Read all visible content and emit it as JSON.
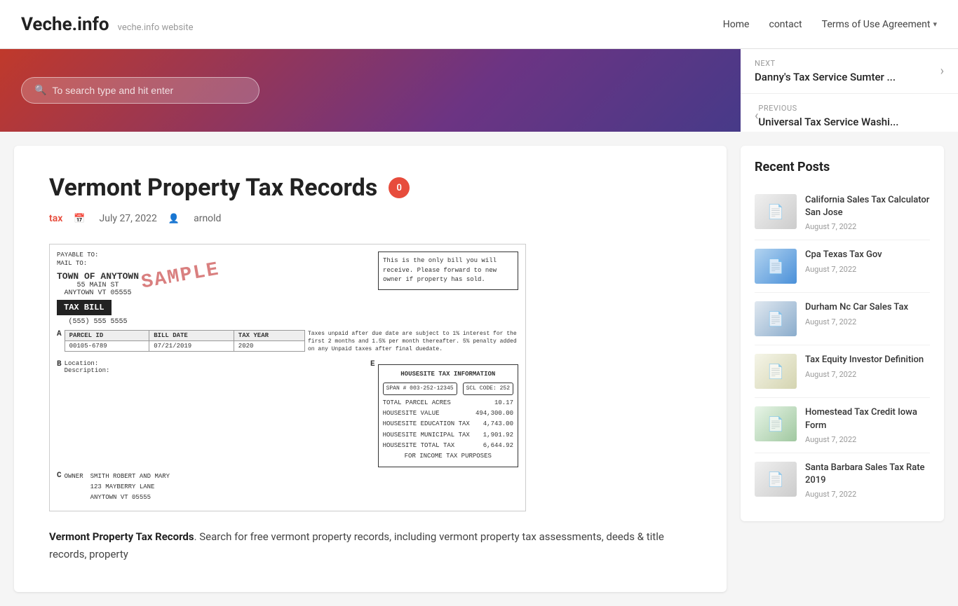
{
  "header": {
    "site_title": "Veche.info",
    "site_tagline": "veche.info website",
    "nav": {
      "home": "Home",
      "contact": "contact",
      "terms": "Terms of Use Agreement"
    }
  },
  "hero": {
    "search_placeholder": "To search type and hit enter"
  },
  "next_nav": {
    "label": "NEXT",
    "title": "Danny's Tax Service Sumter ..."
  },
  "prev_nav": {
    "label": "PREVIOUS",
    "title": "Universal Tax Service Washi..."
  },
  "article": {
    "title": "Vermont Property Tax Records",
    "comment_count": "0",
    "meta_tag": "tax",
    "meta_date": "July 27, 2022",
    "meta_author": "arnold",
    "tax_bill": {
      "payable_to": "PAYABLE TO:",
      "mail_to": "MAIL TO:",
      "sample": "SAMPLE",
      "town": "TOWN OF ANYTOWN",
      "address1": "55 MAIN ST",
      "address2": "ANYTOWN VT 05555",
      "phone": "(555) 555 5555",
      "title": "TAX BILL",
      "note_d": "This is the only bill you will receive. Please forward to new owner if property has sold.",
      "parcel_id": "00105-6789",
      "bill_date": "07/21/2019",
      "tax_year": "2020",
      "interest_note": "Taxes unpaid after due date are subject to 1% interest for the first 2 months and 1.5% per month thereafter. 5% penalty added on any Unpaid taxes after final duedate.",
      "location_label": "Location:",
      "description_label": "Description:",
      "owner_label": "OWNER",
      "owner_name": "SMITH ROBERT AND MARY",
      "owner_addr1": "123 MAYBERRY LANE",
      "owner_addr2": "ANYTOWN VT 05555",
      "housesite_title": "HOUSESITE TAX INFORMATION",
      "span_num": "SPAN # 003-252-12345",
      "scl_code": "SCL CODE: 252",
      "total_parcel_acres_label": "TOTAL PARCEL ACRES",
      "total_parcel_acres_val": "10.17",
      "housesite_value_label": "HOUSESITE VALUE",
      "housesite_value_val": "494,300.00",
      "edu_tax_label": "HOUSESITE EDUCATION TAX",
      "edu_tax_val": "4,743.00",
      "muni_tax_label": "HOUSESITE MUNICIPAL TAX",
      "muni_tax_val": "1,901.92",
      "total_tax_label": "HOUSESITE TOTAL TAX",
      "total_tax_val": "6,644.92",
      "income_label": "FOR INCOME TAX PURPOSES"
    },
    "body_bold": "Vermont Property Tax Records",
    "body_text": ". Search for free vermont property records, including vermont property tax assessments, deeds & title records, property"
  },
  "sidebar": {
    "recent_posts_title": "Recent Posts",
    "posts": [
      {
        "title": "California Sales Tax Calculator San Jose",
        "date": "August 7, 2022",
        "thumb_class": "thumb-1"
      },
      {
        "title": "Cpa Texas Tax Gov",
        "date": "August 7, 2022",
        "thumb_class": "thumb-2"
      },
      {
        "title": "Durham Nc Car Sales Tax",
        "date": "August 7, 2022",
        "thumb_class": "thumb-3"
      },
      {
        "title": "Tax Equity Investor Definition",
        "date": "August 7, 2022",
        "thumb_class": "thumb-4"
      },
      {
        "title": "Homestead Tax Credit Iowa Form",
        "date": "August 7, 2022",
        "thumb_class": "thumb-5"
      },
      {
        "title": "Santa Barbara Sales Tax Rate 2019",
        "date": "August 7, 2022",
        "thumb_class": "thumb-1"
      }
    ]
  }
}
